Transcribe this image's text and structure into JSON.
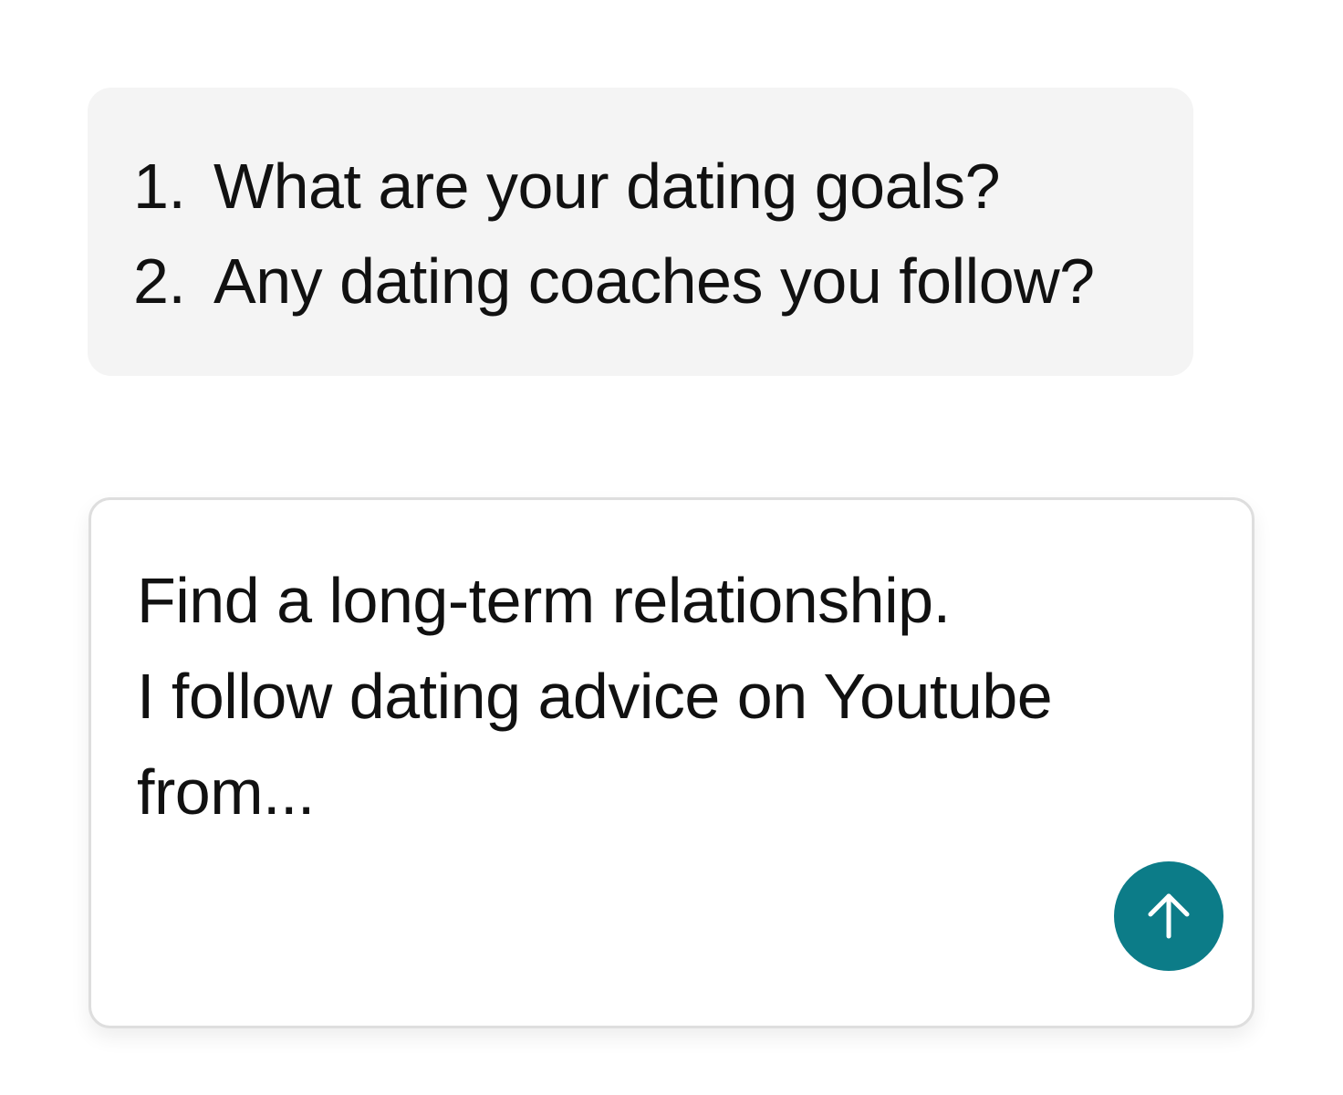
{
  "question": {
    "items": [
      {
        "number": "1.",
        "text": "What are your dating goals?"
      },
      {
        "number": "2.",
        "text": "Any dating coaches you follow?"
      }
    ]
  },
  "reply": {
    "lines": [
      "Find a long-term relationship.",
      "I follow dating advice on Youtube",
      "from..."
    ]
  },
  "send_button": {
    "icon": "arrow-up-icon",
    "color": "#0c7c88",
    "icon_color": "#ffffff"
  },
  "colors": {
    "question_bubble": "#f4f4f4",
    "reply_border": "#dedede",
    "text": "#111111"
  }
}
